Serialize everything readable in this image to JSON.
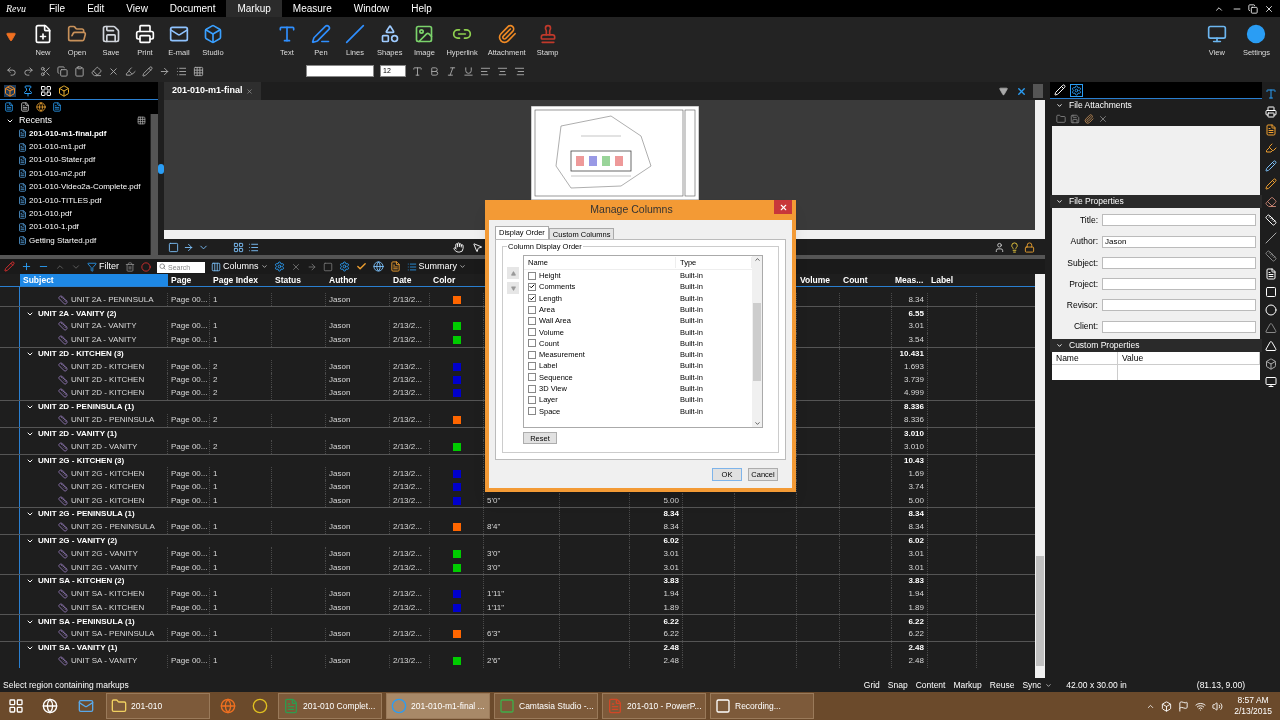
{
  "app": {
    "logo": "Revu"
  },
  "menu": [
    {
      "label": "File",
      "selected": false
    },
    {
      "label": "Edit",
      "selected": false
    },
    {
      "label": "View",
      "selected": false
    },
    {
      "label": "Document",
      "selected": false
    },
    {
      "label": "Markup",
      "selected": true
    },
    {
      "label": "Measure",
      "selected": false
    },
    {
      "label": "Window",
      "selected": false
    },
    {
      "label": "Help",
      "selected": false
    }
  ],
  "ribbon": [
    {
      "label": "New"
    },
    {
      "label": "Open"
    },
    {
      "label": "Save"
    },
    {
      "label": "Print"
    },
    {
      "label": "E-mail"
    },
    {
      "label": "Studio"
    },
    {
      "label": "Text"
    },
    {
      "label": "Pen"
    },
    {
      "label": "Lines"
    },
    {
      "label": "Shapes"
    },
    {
      "label": "Image"
    },
    {
      "label": "Hyperlink"
    },
    {
      "label": "Attachment"
    },
    {
      "label": "Stamp"
    }
  ],
  "ribbon_right": [
    {
      "label": "View"
    },
    {
      "label": "Settings"
    }
  ],
  "format_bar": {
    "font_size": "12"
  },
  "left_panel": {
    "section": "Recents",
    "expanded": true,
    "files": [
      {
        "name": "201-010-m1-final.pdf",
        "current": true
      },
      {
        "name": "201-010-m1.pdf",
        "current": false
      },
      {
        "name": "201-010-Stater.pdf",
        "current": false
      },
      {
        "name": "201-010-m2.pdf",
        "current": false
      },
      {
        "name": "201-010-Video2a-Complete.pdf",
        "current": false
      },
      {
        "name": "201-010-TITLES.pdf",
        "current": false
      },
      {
        "name": "201-010.pdf",
        "current": false
      },
      {
        "name": "201-010-1.pdf",
        "current": false
      },
      {
        "name": "Getting Started.pdf",
        "current": false
      }
    ]
  },
  "document": {
    "tab": "201-010-m1-final"
  },
  "markups": {
    "filter": "Filter",
    "search_placeholder": "Search",
    "columns_button": "Columns",
    "summary_button": "Summary",
    "columns": [
      {
        "label": "Subject",
        "selected": true
      },
      {
        "label": "Page",
        "selected": false
      },
      {
        "label": "Page Index",
        "selected": false
      },
      {
        "label": "Status",
        "selected": false
      },
      {
        "label": "Author",
        "selected": false
      },
      {
        "label": "Date",
        "selected": false
      },
      {
        "label": "Color",
        "selected": false
      },
      {
        "label": "Volume",
        "selected": false
      },
      {
        "label": "Count",
        "selected": false
      },
      {
        "label": "Meas...",
        "selected": false
      },
      {
        "label": "Label",
        "selected": false
      }
    ],
    "groups": [
      {
        "children": [
          {
            "subject": "UNIT 2A - PENINSULA",
            "page": "Page 00...",
            "page_index": "1",
            "author": "Jason",
            "date": "2/13/2...",
            "color": "#ff6600",
            "meas": "8.34"
          }
        ]
      },
      {
        "label": "UNIT 2A - VANITY (2)",
        "expanded": true,
        "meas": "6.55",
        "children": [
          {
            "subject": "UNIT 2A - VANITY",
            "page": "Page 00...",
            "page_index": "1",
            "author": "Jason",
            "date": "2/13/2...",
            "color": "#00cc00",
            "meas": "3.01"
          },
          {
            "subject": "UNIT 2A - VANITY",
            "page": "Page 00...",
            "page_index": "1",
            "author": "Jason",
            "date": "2/13/2...",
            "color": "#00cc00",
            "meas": "3.54"
          }
        ]
      },
      {
        "label": "UNIT 2D - KITCHEN (3)",
        "expanded": true,
        "meas": "10.431",
        "children": [
          {
            "subject": "UNIT 2D - KITCHEN",
            "page": "Page 00...",
            "page_index": "2",
            "author": "Jason",
            "date": "2/13/2...",
            "color": "#0000cc",
            "meas": "1.693"
          },
          {
            "subject": "UNIT 2D - KITCHEN",
            "page": "Page 00...",
            "page_index": "2",
            "author": "Jason",
            "date": "2/13/2...",
            "color": "#0000cc",
            "meas": "3.739"
          },
          {
            "subject": "UNIT 2D - KITCHEN",
            "page": "Page 00...",
            "page_index": "2",
            "author": "Jason",
            "date": "2/13/2...",
            "color": "#0000cc",
            "meas": "4.999"
          }
        ]
      },
      {
        "label": "UNIT 2D - PENINSULA (1)",
        "expanded": true,
        "meas": "8.336",
        "children": [
          {
            "subject": "UNIT 2D - PENINSULA",
            "page": "Page 00...",
            "page_index": "2",
            "author": "Jason",
            "date": "2/13/2...",
            "color": "#ff6600",
            "meas": "8.336"
          }
        ]
      },
      {
        "label": "UNIT 2D - VANITY (1)",
        "expanded": true,
        "meas": "3.010",
        "children": [
          {
            "subject": "UNIT 2D - VANITY",
            "page": "Page 00...",
            "page_index": "2",
            "author": "Jason",
            "date": "2/13/2...",
            "color": "#00cc00",
            "meas": "3.010"
          }
        ]
      },
      {
        "label": "UNIT 2G - KITCHEN (3)",
        "expanded": true,
        "meas": "10.43",
        "children": [
          {
            "subject": "UNIT 2G - KITCHEN",
            "page": "Page 00...",
            "page_index": "1",
            "author": "Jason",
            "date": "2/13/2...",
            "color": "#0000cc",
            "meas": "1.69"
          },
          {
            "subject": "UNIT 2G - KITCHEN",
            "page": "Page 00...",
            "page_index": "1",
            "author": "Jason",
            "date": "2/13/2...",
            "color": "#0000cc",
            "meas": "3.74"
          },
          {
            "subject": "UNIT 2G - KITCHEN",
            "page": "Page 00...",
            "page_index": "1",
            "author": "Jason",
            "date": "2/13/2...",
            "color": "#0000cc",
            "column_8": "5'0\"",
            "column_10": "5.00",
            "meas": "5.00"
          }
        ]
      },
      {
        "label": "UNIT 2G - PENINSULA (1)",
        "expanded": true,
        "column_10": "8.34",
        "meas": "8.34",
        "children": [
          {
            "subject": "UNIT 2G - PENINSULA",
            "page": "Page 00...",
            "page_index": "1",
            "author": "Jason",
            "date": "2/13/2...",
            "color": "#ff6600",
            "column_8": "8'4\"",
            "column_10": "8.34",
            "meas": "8.34"
          }
        ]
      },
      {
        "label": "UNIT 2G - VANITY (2)",
        "expanded": true,
        "column_10": "6.02",
        "meas": "6.02",
        "children": [
          {
            "subject": "UNIT 2G - VANITY",
            "page": "Page 00...",
            "page_index": "1",
            "author": "Jason",
            "date": "2/13/2...",
            "color": "#00cc00",
            "column_8": "3'0\"",
            "column_10": "3.01",
            "meas": "3.01"
          },
          {
            "subject": "UNIT 2G - VANITY",
            "page": "Page 00...",
            "page_index": "1",
            "author": "Jason",
            "date": "2/13/2...",
            "color": "#00cc00",
            "column_8": "3'0\"",
            "column_10": "3.01",
            "meas": "3.01"
          }
        ]
      },
      {
        "label": "UNIT SA - KITCHEN (2)",
        "expanded": true,
        "column_10": "3.83",
        "meas": "3.83",
        "children": [
          {
            "subject": "UNIT SA - KITCHEN",
            "page": "Page 00...",
            "page_index": "1",
            "author": "Jason",
            "date": "2/13/2...",
            "color": "#0000cc",
            "column_8": "1'11\"",
            "column_10": "1.94",
            "meas": "1.94"
          },
          {
            "subject": "UNIT SA - KITCHEN",
            "page": "Page 00...",
            "page_index": "1",
            "author": "Jason",
            "date": "2/13/2...",
            "color": "#0000cc",
            "column_8": "1'11\"",
            "column_10": "1.89",
            "meas": "1.89"
          }
        ]
      },
      {
        "label": "UNIT SA - PENINSULA (1)",
        "expanded": true,
        "column_10": "6.22",
        "meas": "6.22",
        "children": [
          {
            "subject": "UNIT SA - PENINSULA",
            "page": "Page 00...",
            "page_index": "1",
            "author": "Jason",
            "date": "2/13/2...",
            "color": "#ff6600",
            "column_8": "6'3\"",
            "column_10": "6.22",
            "meas": "6.22"
          }
        ]
      },
      {
        "label": "UNIT SA - VANITY (1)",
        "expanded": true,
        "column_10": "2.48",
        "meas": "2.48",
        "children": [
          {
            "subject": "UNIT SA - VANITY",
            "page": "Page 00...",
            "page_index": "1",
            "author": "Jason",
            "date": "2/13/2...",
            "color": "#00cc00",
            "column_8": "2'6\"",
            "column_10": "2.48",
            "meas": "2.48"
          }
        ]
      }
    ]
  },
  "dialog": {
    "title": "Manage Columns",
    "tabs": [
      {
        "label": "Display Order",
        "selected": true
      },
      {
        "label": "Custom Columns",
        "selected": false
      }
    ],
    "group": "Column Display Order",
    "headers": [
      "Name",
      "Type"
    ],
    "items": [
      {
        "name": "Height",
        "type": "Built-in",
        "checked": false
      },
      {
        "name": "Comments",
        "type": "Built-in",
        "checked": true
      },
      {
        "name": "Length",
        "type": "Built-in",
        "checked": true
      },
      {
        "name": "Area",
        "type": "Built-in",
        "checked": false
      },
      {
        "name": "Wall Area",
        "type": "Built-in",
        "checked": false
      },
      {
        "name": "Volume",
        "type": "Built-in",
        "checked": false
      },
      {
        "name": "Count",
        "type": "Built-in",
        "checked": false
      },
      {
        "name": "Measurement",
        "type": "Built-in",
        "checked": false
      },
      {
        "name": "Label",
        "type": "Built-in",
        "checked": false
      },
      {
        "name": "Sequence",
        "type": "Built-in",
        "checked": false
      },
      {
        "name": "3D View",
        "type": "Built-in",
        "checked": false
      },
      {
        "name": "Layer",
        "type": "Built-in",
        "checked": false
      },
      {
        "name": "Space",
        "type": "Built-in",
        "checked": false
      }
    ],
    "buttons": [
      "Reset",
      "OK",
      "Cancel"
    ]
  },
  "properties": {
    "attachments_title": "File Attachments",
    "properties_title": "File Properties",
    "fields": [
      {
        "label": "Title:"
      },
      {
        "label": "Author:",
        "value": "Jason"
      },
      {
        "label": "Subject:"
      },
      {
        "label": "Project:"
      },
      {
        "label": "Revisor:"
      },
      {
        "label": "Client:"
      }
    ],
    "custom_title": "Custom Properties",
    "custom_headers": [
      "Name",
      "Value"
    ]
  },
  "status_bar": {
    "message": "Select region containing markups",
    "toggles": [
      "Grid",
      "Snap",
      "Content",
      "Markup",
      "Reuse",
      "Sync"
    ],
    "size": "42.00 x 30.00 in",
    "coords": "(81.13, 9.00)"
  },
  "taskbar": {
    "items": [
      {
        "kind": "folder",
        "label": "201-010",
        "selected": false
      },
      {
        "kind": "excel",
        "label": "201-010 Complet...",
        "selected": false
      },
      {
        "kind": "revu",
        "label": "201-010-m1-final ...",
        "selected": true
      },
      {
        "kind": "camtasia",
        "label": "Camtasia Studio -...",
        "selected": false
      },
      {
        "kind": "powerpoint",
        "label": "201-010 - PowerP...",
        "selected": false
      },
      {
        "kind": "recording",
        "label": "Recording...",
        "selected": false
      }
    ],
    "time": "8:57 AM",
    "date": "2/13/2015"
  }
}
